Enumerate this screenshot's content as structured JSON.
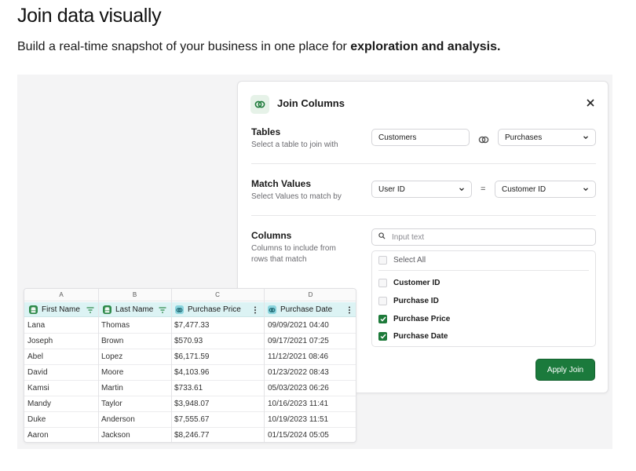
{
  "hero": {
    "title": "Join data visually",
    "subtitle_prefix": "Build a real-time snapshot of your business in one place for ",
    "subtitle_bold": "exploration and analysis."
  },
  "panel": {
    "title": "Join Columns",
    "tables": {
      "title": "Tables",
      "desc": "Select a table to join with",
      "left_value": "Customers",
      "right_value": "Purchases"
    },
    "match": {
      "title": "Match Values",
      "desc": "Select Values to match by",
      "left_value": "User ID",
      "operator": "=",
      "right_value": "Customer ID"
    },
    "columns": {
      "title": "Columns",
      "desc_line1": "Columns to include from",
      "desc_line2": "rows that match",
      "search_placeholder": "Input text",
      "select_all": "Select All",
      "items": [
        {
          "label": "Customer ID",
          "checked": false
        },
        {
          "label": "Purchase ID",
          "checked": false
        },
        {
          "label": "Purchase Price",
          "checked": true
        },
        {
          "label": "Purchase Date",
          "checked": true
        }
      ]
    },
    "apply_label": "Apply Join"
  },
  "sheet": {
    "letters": [
      "A",
      "B",
      "C",
      "D"
    ],
    "headers": [
      "First Name",
      "Last Name",
      "Purchase Price",
      "Purchase Date"
    ],
    "rows": [
      [
        "Lana",
        "Thomas",
        "$7,477.33",
        "09/09/2021 04:40"
      ],
      [
        "Joseph",
        "Brown",
        "$570.93",
        "09/17/2021 07:25"
      ],
      [
        "Abel",
        "Lopez",
        "$6,171.59",
        "11/12/2021 08:46"
      ],
      [
        "David",
        "Moore",
        "$4,103.96",
        "01/23/2022 08:43"
      ],
      [
        "Kamsi",
        "Martin",
        "$733.61",
        "05/03/2023 06:26"
      ],
      [
        "Mandy",
        "Taylor",
        "$3,948.07",
        "10/16/2023 11:41"
      ],
      [
        "Duke",
        "Anderson",
        "$7,555.67",
        "10/19/2023 11:51"
      ],
      [
        "Aaron",
        "Jackson",
        "$8,246.77",
        "01/15/2024 05:05"
      ]
    ]
  },
  "colors": {
    "accent_green": "#1b7a3c",
    "header_teal": "#dcf3f4",
    "stage_bg": "#f4f4f5"
  }
}
